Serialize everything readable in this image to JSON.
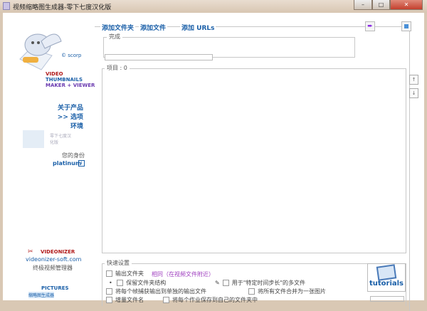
{
  "window": {
    "title": "视频缩略图生成器-零下七度汉化版",
    "minimize": "–",
    "maximize": "□",
    "close": "✕"
  },
  "logo": {
    "copyright": "© scorp",
    "line1": "VIDEO",
    "line2": "THUMBNAILS",
    "line3": "MAKER + VIEWER"
  },
  "sidebar": {
    "links": [
      "关于产品",
      ">> 选项",
      "环境"
    ],
    "watermark": "零下七度汉化版",
    "identity_label": "您的身份",
    "identity_value": "platinum",
    "info_icon": "i"
  },
  "promo": {
    "brand": "VIDEONIZER",
    "url": "videonizer-soft.com",
    "desc": "终极视频管理器",
    "pictures": "PICTURES",
    "pictures_sub": "缩略图生成器"
  },
  "tabs": {
    "add_folder": "添加文件夹",
    "add_files": "添加文件",
    "add_urls": "添加 URLs"
  },
  "done_group": {
    "label": "完成",
    "progress": 0
  },
  "items_group": {
    "label": "项目 : 0"
  },
  "scroll": {
    "up": "↑",
    "down": "↓"
  },
  "quick": {
    "label": "快速设置",
    "output_folder": "输出文件夹",
    "output_link": "相同（在视频文件附近）",
    "keep_structure": "保留文件夹结构",
    "specific_step": "用于\"特定时间步长\"的多文件",
    "separate_output": "将每个帧捕获输出到单独的输出文件",
    "merge_all": "将所有文件合并为一张图片",
    "batch_rename": "增量文件名",
    "own_folder": "将每个作业保存到自己的文件夹中"
  },
  "tutorials": "tutorials"
}
